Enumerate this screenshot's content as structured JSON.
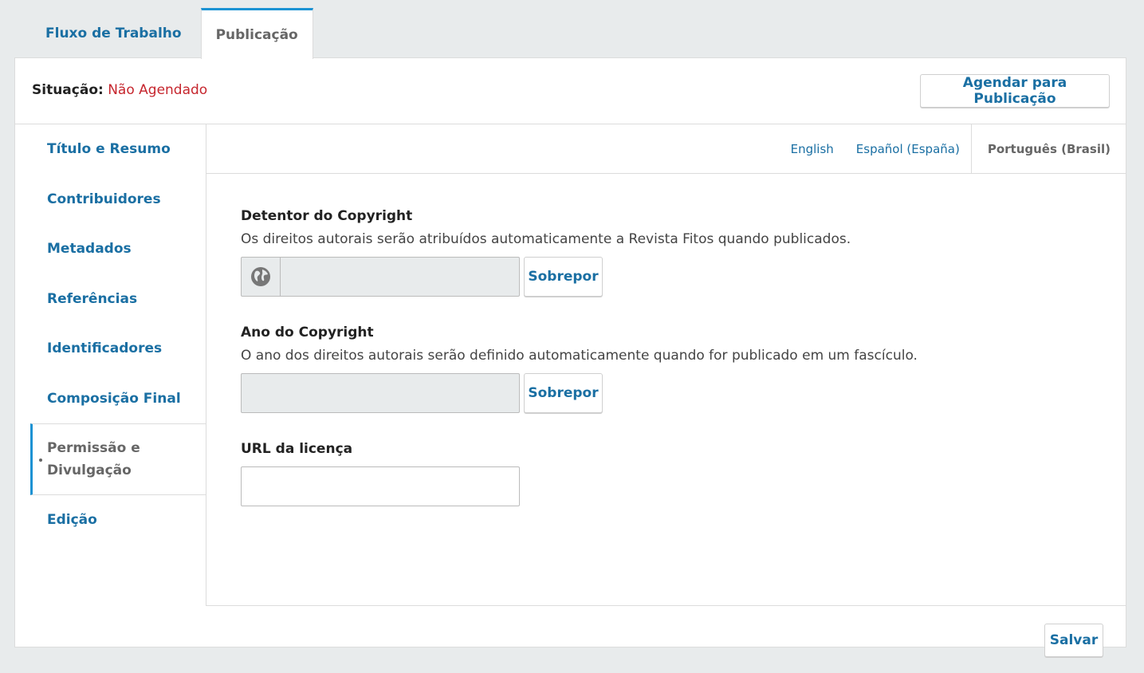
{
  "tabs": {
    "workflow": "Fluxo de Trabalho",
    "publication": "Publicação"
  },
  "status": {
    "label": "Situação:",
    "value": "Não Agendado"
  },
  "schedule_button": "Agendar para Publicação",
  "sidebar": {
    "items": [
      "Título e Resumo",
      "Contribuidores",
      "Metadados",
      "Referências",
      "Identificadores",
      "Composição Final",
      "Permissão e Divulgação",
      "Edição"
    ],
    "active_index": 6
  },
  "locales": {
    "en": "English",
    "es": "Español (España)",
    "pt": "Português (Brasil)",
    "current": "Português (Brasil)"
  },
  "form": {
    "copyright_holder": {
      "label": "Detentor do Copyright",
      "description": "Os direitos autorais serão atribuídos automaticamente a Revista Fitos quando publicados.",
      "value": "",
      "override_label": "Sobrepor"
    },
    "copyright_year": {
      "label": "Ano do Copyright",
      "description": "O ano dos direitos autorais serão definido automaticamente quando for publicado em um fascículo.",
      "value": "",
      "override_label": "Sobrepor"
    },
    "license_url": {
      "label": "URL da licença",
      "value": ""
    }
  },
  "save_button": "Salvar",
  "icons": {
    "globe": "globe-icon"
  },
  "colors": {
    "accent": "#1a6fa3",
    "active_border": "#1b92d3",
    "status_red": "#c6262e"
  }
}
